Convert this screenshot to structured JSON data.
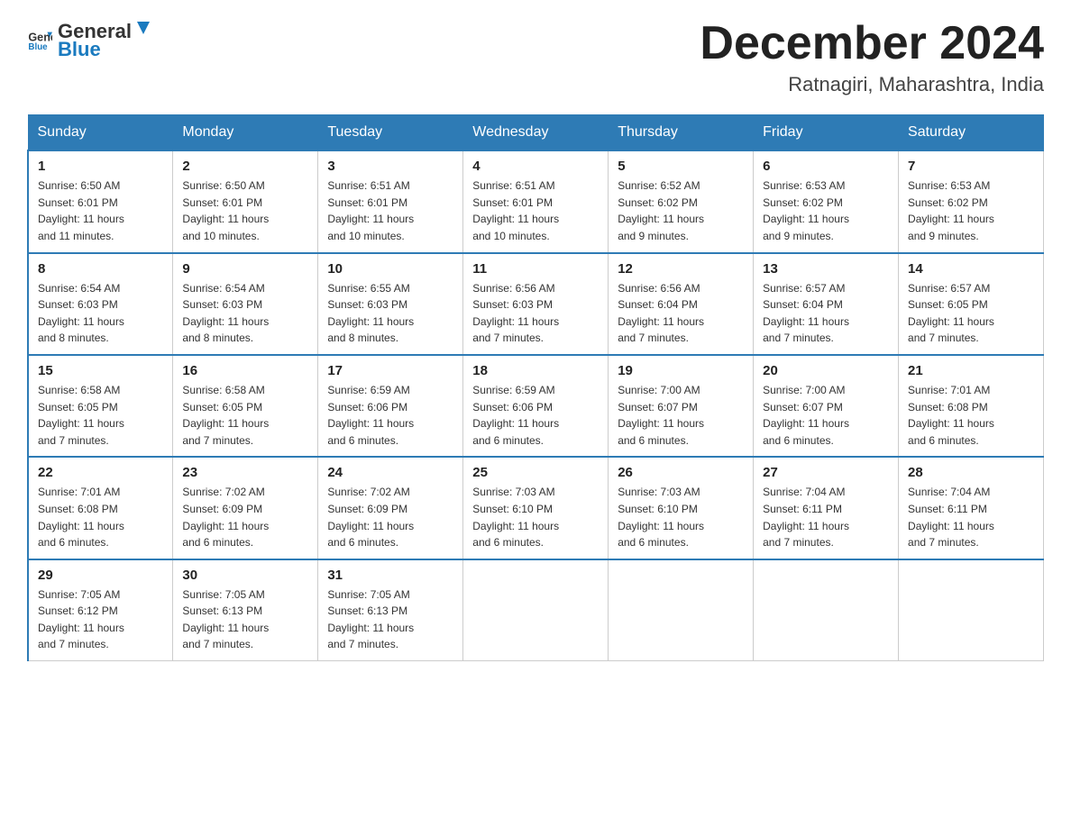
{
  "header": {
    "logo_general": "General",
    "logo_blue": "Blue",
    "month_year": "December 2024",
    "location": "Ratnagiri, Maharashtra, India"
  },
  "days_of_week": [
    "Sunday",
    "Monday",
    "Tuesday",
    "Wednesday",
    "Thursday",
    "Friday",
    "Saturday"
  ],
  "weeks": [
    [
      {
        "day": "1",
        "sunrise": "6:50 AM",
        "sunset": "6:01 PM",
        "daylight": "11 hours and 11 minutes."
      },
      {
        "day": "2",
        "sunrise": "6:50 AM",
        "sunset": "6:01 PM",
        "daylight": "11 hours and 10 minutes."
      },
      {
        "day": "3",
        "sunrise": "6:51 AM",
        "sunset": "6:01 PM",
        "daylight": "11 hours and 10 minutes."
      },
      {
        "day": "4",
        "sunrise": "6:51 AM",
        "sunset": "6:01 PM",
        "daylight": "11 hours and 10 minutes."
      },
      {
        "day": "5",
        "sunrise": "6:52 AM",
        "sunset": "6:02 PM",
        "daylight": "11 hours and 9 minutes."
      },
      {
        "day": "6",
        "sunrise": "6:53 AM",
        "sunset": "6:02 PM",
        "daylight": "11 hours and 9 minutes."
      },
      {
        "day": "7",
        "sunrise": "6:53 AM",
        "sunset": "6:02 PM",
        "daylight": "11 hours and 9 minutes."
      }
    ],
    [
      {
        "day": "8",
        "sunrise": "6:54 AM",
        "sunset": "6:03 PM",
        "daylight": "11 hours and 8 minutes."
      },
      {
        "day": "9",
        "sunrise": "6:54 AM",
        "sunset": "6:03 PM",
        "daylight": "11 hours and 8 minutes."
      },
      {
        "day": "10",
        "sunrise": "6:55 AM",
        "sunset": "6:03 PM",
        "daylight": "11 hours and 8 minutes."
      },
      {
        "day": "11",
        "sunrise": "6:56 AM",
        "sunset": "6:03 PM",
        "daylight": "11 hours and 7 minutes."
      },
      {
        "day": "12",
        "sunrise": "6:56 AM",
        "sunset": "6:04 PM",
        "daylight": "11 hours and 7 minutes."
      },
      {
        "day": "13",
        "sunrise": "6:57 AM",
        "sunset": "6:04 PM",
        "daylight": "11 hours and 7 minutes."
      },
      {
        "day": "14",
        "sunrise": "6:57 AM",
        "sunset": "6:05 PM",
        "daylight": "11 hours and 7 minutes."
      }
    ],
    [
      {
        "day": "15",
        "sunrise": "6:58 AM",
        "sunset": "6:05 PM",
        "daylight": "11 hours and 7 minutes."
      },
      {
        "day": "16",
        "sunrise": "6:58 AM",
        "sunset": "6:05 PM",
        "daylight": "11 hours and 7 minutes."
      },
      {
        "day": "17",
        "sunrise": "6:59 AM",
        "sunset": "6:06 PM",
        "daylight": "11 hours and 6 minutes."
      },
      {
        "day": "18",
        "sunrise": "6:59 AM",
        "sunset": "6:06 PM",
        "daylight": "11 hours and 6 minutes."
      },
      {
        "day": "19",
        "sunrise": "7:00 AM",
        "sunset": "6:07 PM",
        "daylight": "11 hours and 6 minutes."
      },
      {
        "day": "20",
        "sunrise": "7:00 AM",
        "sunset": "6:07 PM",
        "daylight": "11 hours and 6 minutes."
      },
      {
        "day": "21",
        "sunrise": "7:01 AM",
        "sunset": "6:08 PM",
        "daylight": "11 hours and 6 minutes."
      }
    ],
    [
      {
        "day": "22",
        "sunrise": "7:01 AM",
        "sunset": "6:08 PM",
        "daylight": "11 hours and 6 minutes."
      },
      {
        "day": "23",
        "sunrise": "7:02 AM",
        "sunset": "6:09 PM",
        "daylight": "11 hours and 6 minutes."
      },
      {
        "day": "24",
        "sunrise": "7:02 AM",
        "sunset": "6:09 PM",
        "daylight": "11 hours and 6 minutes."
      },
      {
        "day": "25",
        "sunrise": "7:03 AM",
        "sunset": "6:10 PM",
        "daylight": "11 hours and 6 minutes."
      },
      {
        "day": "26",
        "sunrise": "7:03 AM",
        "sunset": "6:10 PM",
        "daylight": "11 hours and 6 minutes."
      },
      {
        "day": "27",
        "sunrise": "7:04 AM",
        "sunset": "6:11 PM",
        "daylight": "11 hours and 7 minutes."
      },
      {
        "day": "28",
        "sunrise": "7:04 AM",
        "sunset": "6:11 PM",
        "daylight": "11 hours and 7 minutes."
      }
    ],
    [
      {
        "day": "29",
        "sunrise": "7:05 AM",
        "sunset": "6:12 PM",
        "daylight": "11 hours and 7 minutes."
      },
      {
        "day": "30",
        "sunrise": "7:05 AM",
        "sunset": "6:13 PM",
        "daylight": "11 hours and 7 minutes."
      },
      {
        "day": "31",
        "sunrise": "7:05 AM",
        "sunset": "6:13 PM",
        "daylight": "11 hours and 7 minutes."
      },
      null,
      null,
      null,
      null
    ]
  ],
  "labels": {
    "sunrise": "Sunrise:",
    "sunset": "Sunset:",
    "daylight": "Daylight:"
  }
}
